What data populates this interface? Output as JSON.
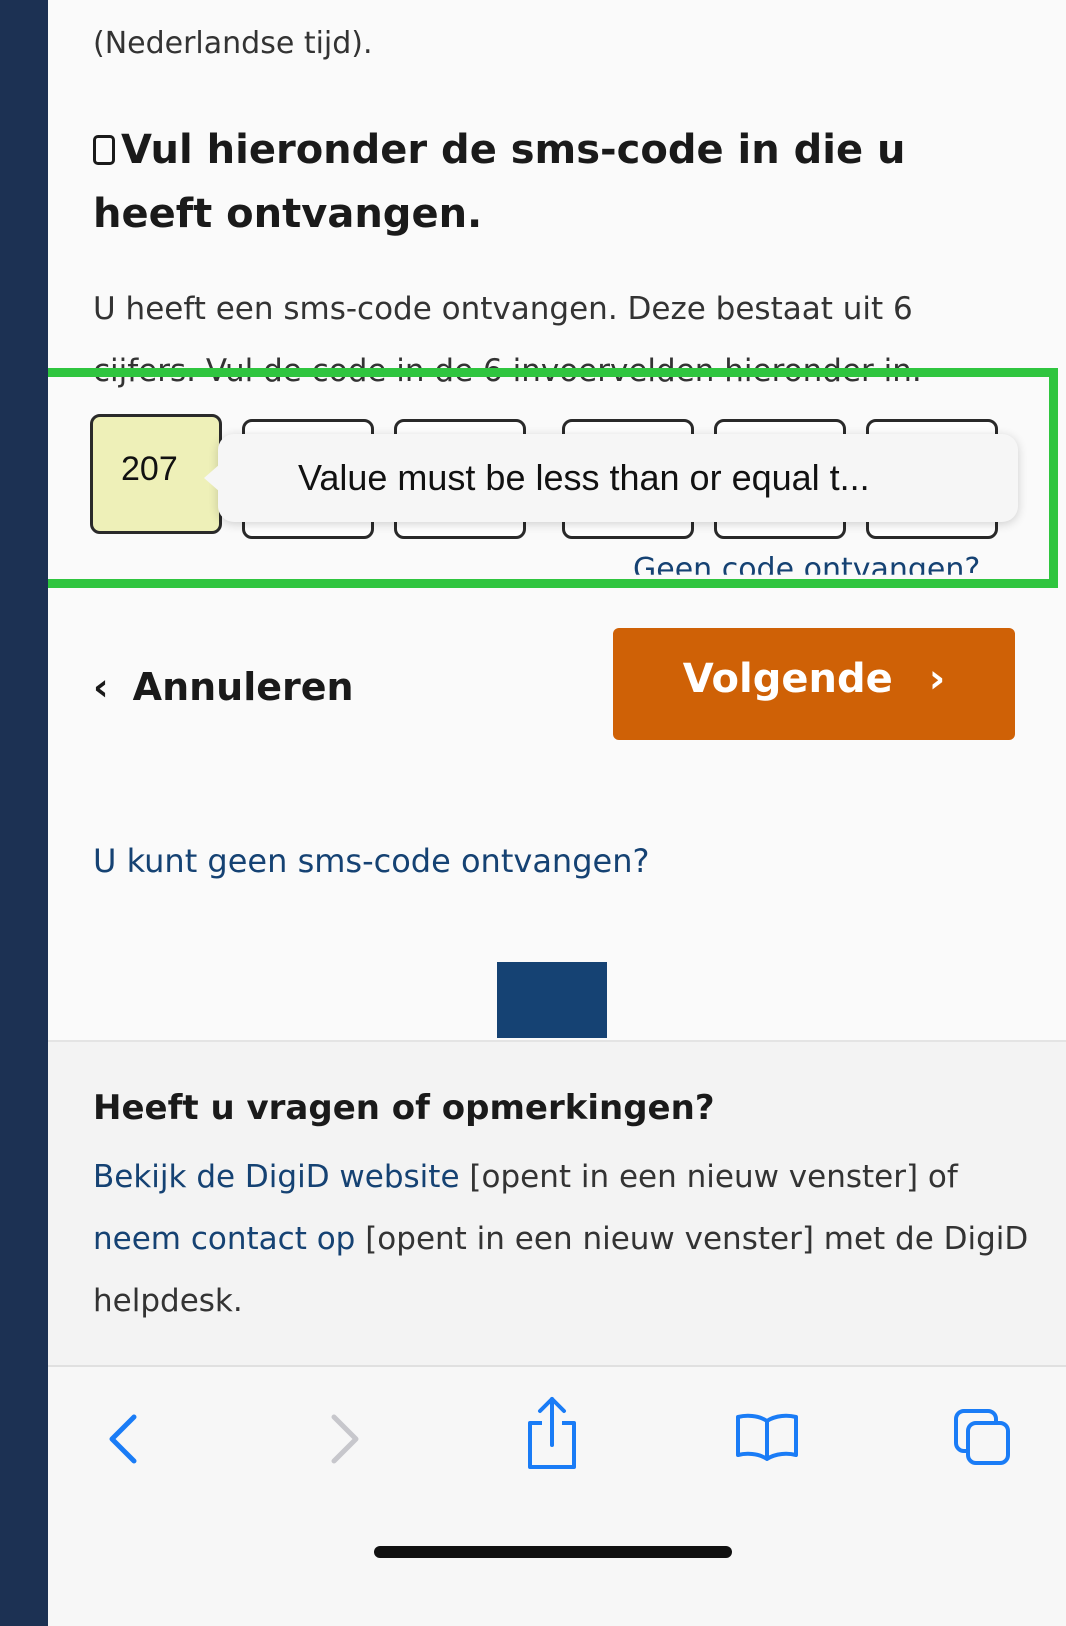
{
  "page": {
    "note_top": "(Nederlandse tijd).",
    "heading": "Vul hieronder de sms-code in die u heeft ontvangen.",
    "intro": "U heeft een sms-code ontvangen. Deze bestaat uit 6 cijfers. Vul de code in de 6 invoervelden hieronder in."
  },
  "otp": {
    "fields": [
      "207",
      "",
      "",
      "",
      "",
      ""
    ],
    "tooltip": "Value must be less than or equal t...",
    "no_code_link": "Geen code ontvangen?"
  },
  "actions": {
    "cancel_label": "Annuleren",
    "next_label": "Volgende"
  },
  "links": {
    "no_sms": "U kunt geen sms-code ontvangen?"
  },
  "footer": {
    "title": "Heeft u vragen of opmerkingen?",
    "link1": "Bekijk de DigiD website",
    "text1": " [opent in een nieuw venster] of ",
    "link2": "neem contact op",
    "text2": " [opent in een nieuw venster] met de DigiD helpdesk."
  },
  "colors": {
    "brand_blue": "#154273",
    "button_orange": "#cf6106",
    "highlight_green": "#2fc53f",
    "filled_field": "#eef0b8",
    "ios_blue": "#1a7cf6"
  },
  "toolbar": {
    "icons": [
      "back-icon",
      "forward-icon",
      "share-icon",
      "bookmarks-icon",
      "tabs-icon"
    ]
  }
}
